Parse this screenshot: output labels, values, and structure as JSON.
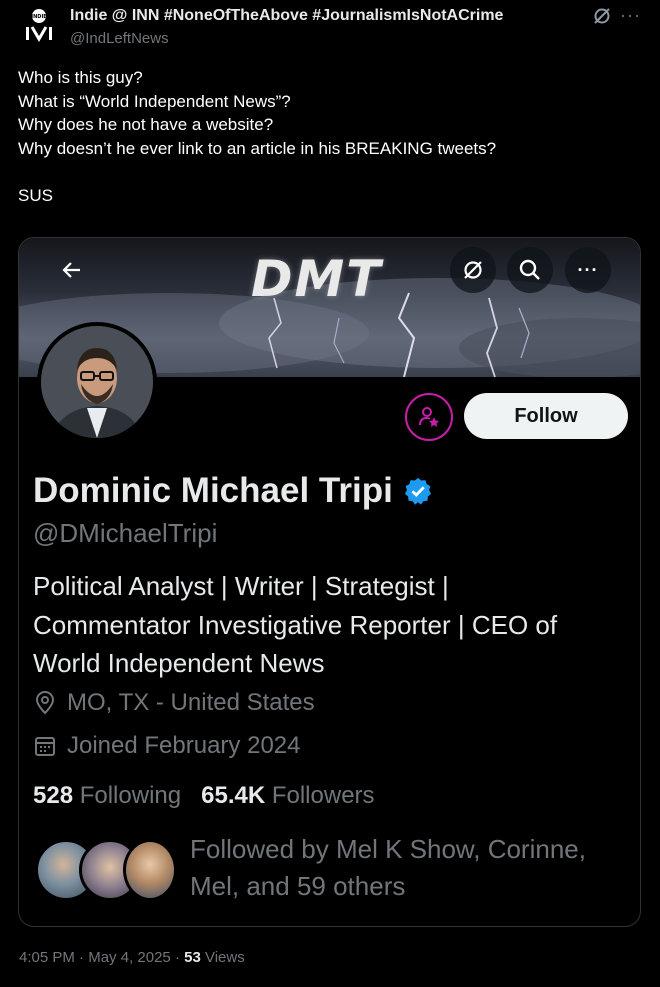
{
  "tweet": {
    "author_name": "Indie @ INN #NoneOfTheAbove #JournalismIsNotACrime",
    "author_handle": "@IndLeftNews",
    "avatar_text": "INDIE",
    "text_lines": [
      "Who is this guy?",
      "What is “World Independent News”?",
      "Why does he not have a website?",
      "Why doesn’t he ever link to an article in his BREAKING tweets?",
      "",
      "SUS"
    ],
    "time": "4:05 PM",
    "date": "May 4, 2025",
    "separator": "·",
    "views_count": "53",
    "views_label": "Views"
  },
  "embed": {
    "banner_logo": "DMT",
    "follow_label": "Follow",
    "profile": {
      "name": "Dominic Michael Tripi",
      "handle": "@DMichaelTripi",
      "bio_lines": [
        "Political Analyst | Writer | Strategist |",
        "Commentator Investigative Reporter | CEO of",
        "World Independent News"
      ],
      "location": "MO, TX - United States",
      "joined": "Joined February 2024",
      "following_count": "528",
      "following_label": "Following",
      "followers_count": "65.4K",
      "followers_label": "Followers",
      "followed_by_lines": [
        "Followed by Mel K Show, Corinne,",
        "Mel, and 59 others"
      ]
    }
  },
  "icons": [
    "grok-icon",
    "more-icon",
    "back-arrow-icon",
    "search-icon",
    "subscribe-icon",
    "verified-badge-icon",
    "location-icon",
    "calendar-icon"
  ],
  "colors": {
    "background": "#000000",
    "text": "#e7e9ea",
    "muted": "#71767b",
    "verified": "#1d9bf0",
    "subscribe_accent": "#c81da6",
    "follow_bg": "#eff3f4"
  }
}
